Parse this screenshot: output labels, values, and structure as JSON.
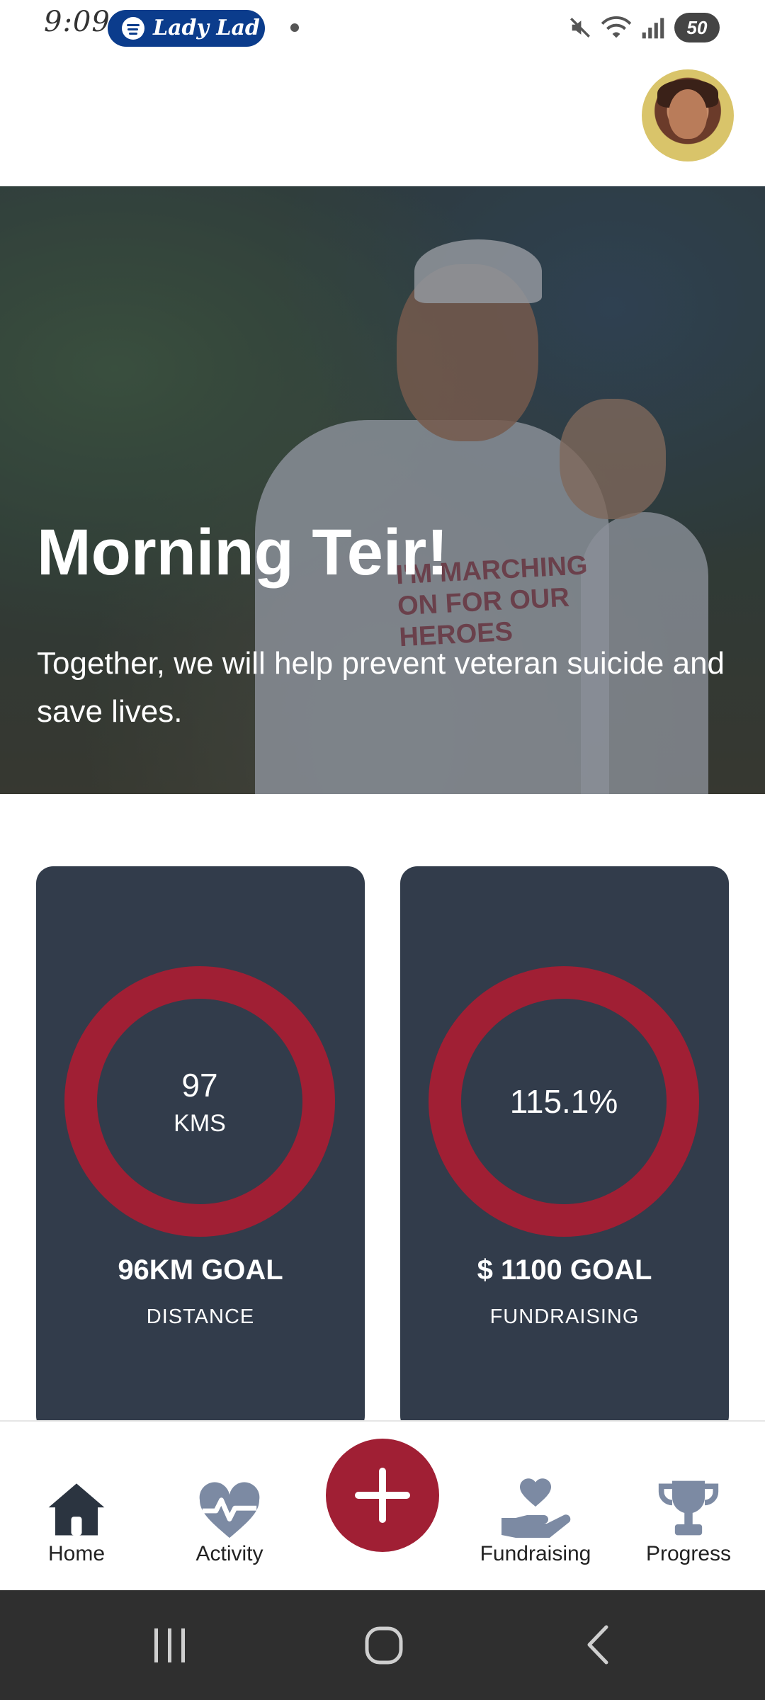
{
  "status_bar": {
    "time": "9:09",
    "media_label": "Lady Lad",
    "battery": "50"
  },
  "hero": {
    "title": "Morning Teir!",
    "subtitle": "Together, we will help prevent veteran suicide and save lives.",
    "photo_text": "I'M MARCHING ON FOR OUR HEROES"
  },
  "stats": [
    {
      "value": "97",
      "unit": "KMS",
      "goal": "96KM GOAL",
      "label": "DISTANCE",
      "progress": 1.0
    },
    {
      "value": "115.1%",
      "unit": "",
      "goal": "$ 1100 GOAL",
      "label": "FUNDRAISING",
      "progress": 1.0
    }
  ],
  "nav": {
    "home": "Home",
    "activity": "Activity",
    "fundraising": "Fundraising",
    "progress": "Progress"
  },
  "colors": {
    "accent": "#a01f34",
    "card": "#323c4b",
    "nav_icon": "#7c8aa3",
    "system_nav": "#2f2f2f"
  },
  "icons": [
    "spotify-icon",
    "mute-icon",
    "wifi-icon",
    "signal-icon",
    "battery-icon",
    "home-icon",
    "heartbeat-icon",
    "plus-icon",
    "hand-heart-icon",
    "trophy-icon",
    "recents-icon",
    "home-circle-icon",
    "back-icon"
  ]
}
